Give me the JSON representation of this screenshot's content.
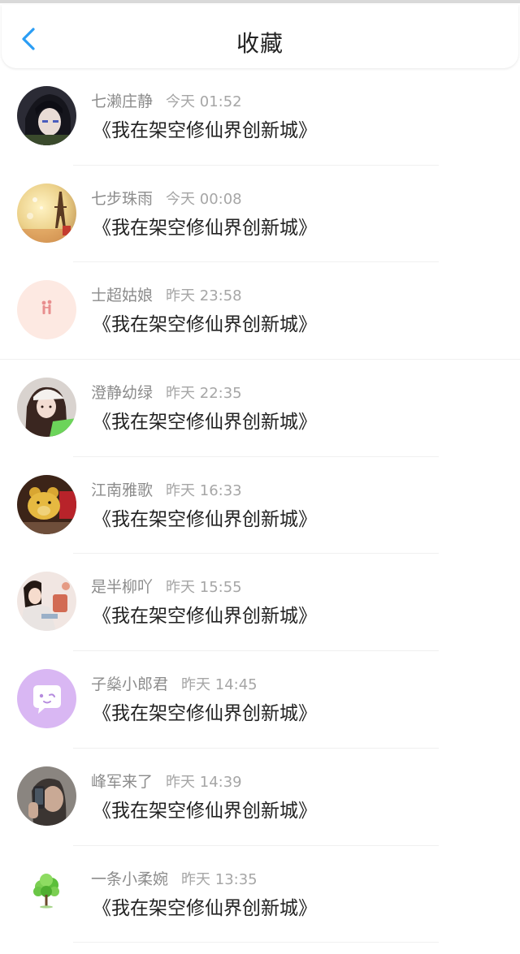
{
  "header": {
    "title": "收藏",
    "back_icon": "chevron-left-icon",
    "accent_color": "#2a9df4"
  },
  "favorites": [
    {
      "username": "七濑庄静",
      "timestamp": "今天 01:52",
      "book_title": "《我在架空修仙界创新城》",
      "avatar": "anime-boy-avatar"
    },
    {
      "username": "七步珠雨",
      "timestamp": "今天 00:08",
      "book_title": "《我在架空修仙界创新城》",
      "avatar": "eiffel-tower-avatar"
    },
    {
      "username": "士超姑娘",
      "timestamp": "昨天 23:58",
      "book_title": "《我在架空修仙界创新城》",
      "avatar": "couple-silhouette-avatar"
    },
    {
      "username": "澄静幼绿",
      "timestamp": "昨天 22:35",
      "book_title": "《我在架空修仙界创新城》",
      "avatar": "girl-with-cap-avatar"
    },
    {
      "username": "江南雅歌",
      "timestamp": "昨天 16:33",
      "book_title": "《我在架空修仙界创新城》",
      "avatar": "teddy-bear-avatar"
    },
    {
      "username": "是半柳吖",
      "timestamp": "昨天 15:55",
      "book_title": "《我在架空修仙界创新城》",
      "avatar": "child-photo-avatar"
    },
    {
      "username": "子燊小郎君",
      "timestamp": "昨天 14:45",
      "book_title": "《我在架空修仙界创新城》",
      "avatar": "chat-bubble-avatar"
    },
    {
      "username": "峰军来了",
      "timestamp": "昨天 14:39",
      "book_title": "《我在架空修仙界创新城》",
      "avatar": "phone-selfie-avatar"
    },
    {
      "username": "一条小柔婉",
      "timestamp": "昨天 13:35",
      "book_title": "《我在架空修仙界创新城》",
      "avatar": "green-tree-avatar"
    }
  ]
}
